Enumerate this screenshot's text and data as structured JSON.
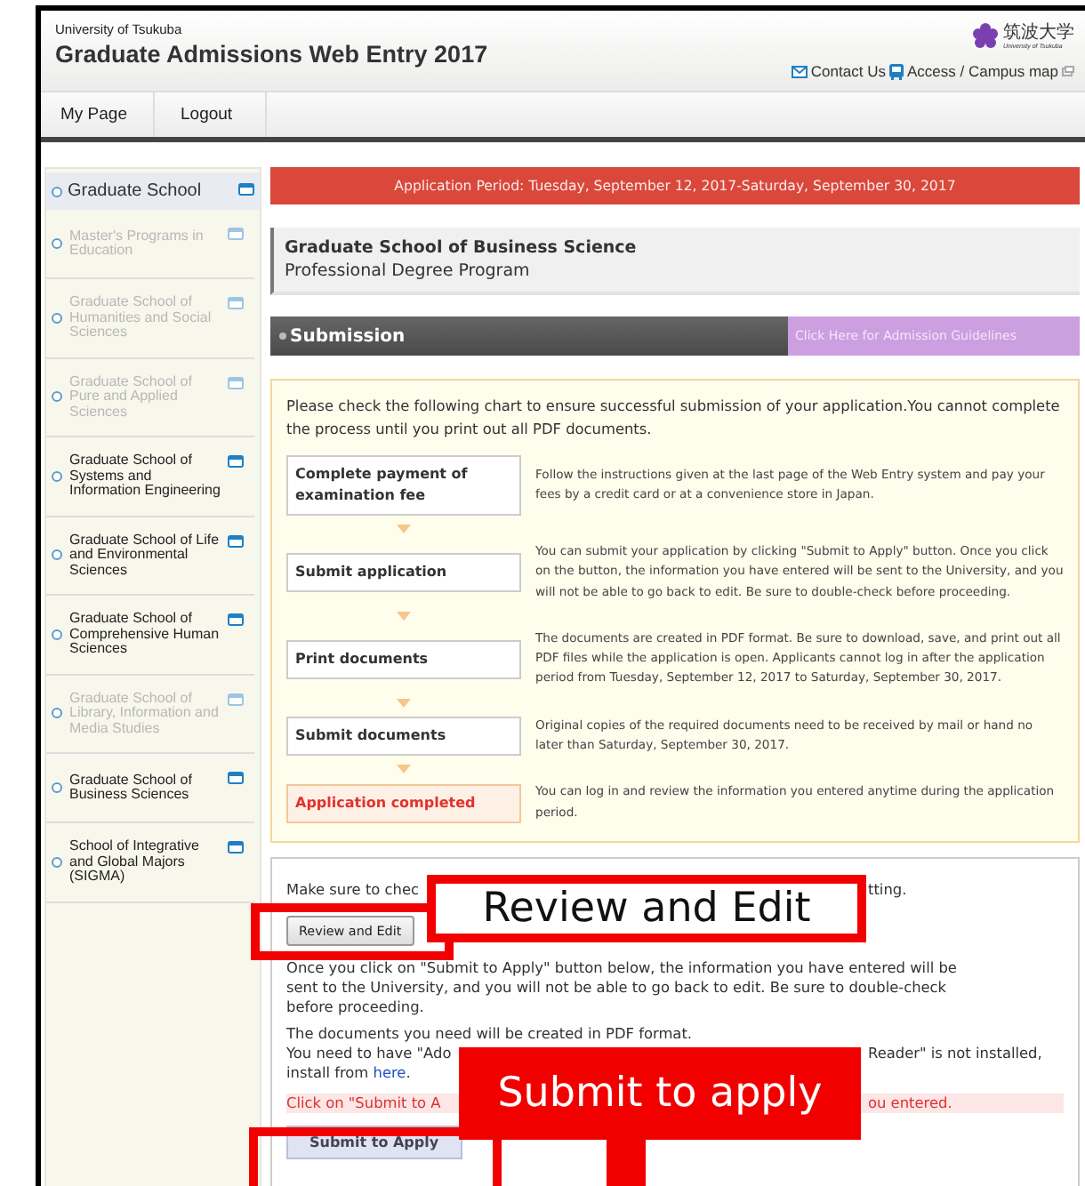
{
  "header": {
    "university": "University of Tsukuba",
    "title": "Graduate Admissions Web Entry 2017",
    "logo_text": "筑波大学",
    "logo_sub": "University of Tsukuba",
    "links": [
      {
        "label": "Contact Us",
        "kind": "mail"
      },
      {
        "label": "Access / Campus map",
        "kind": "bus"
      }
    ]
  },
  "nav": [
    {
      "label": "My Page"
    },
    {
      "label": "Logout"
    }
  ],
  "sidebar": {
    "heading": "Graduate School",
    "items": [
      {
        "label": "Master's Programs in Education",
        "disabled": true
      },
      {
        "label": "Graduate School of Humanities and Social Sciences",
        "disabled": true
      },
      {
        "label": "Graduate School of Pure and Applied Sciences",
        "disabled": true
      },
      {
        "label": "Graduate School of Systems and Information Engineering",
        "disabled": false
      },
      {
        "label": "Graduate School of Life and Environmental Sciences",
        "disabled": false
      },
      {
        "label": "Graduate School of Comprehensive Human Sciences",
        "disabled": false
      },
      {
        "label": "Graduate School of Library, Information and Media Studies",
        "disabled": true
      },
      {
        "label": "Graduate School of Business Sciences",
        "disabled": false
      },
      {
        "label": "School of Integrative and Global Majors (SIGMA)",
        "disabled": false
      }
    ]
  },
  "period": "Application Period: Tuesday, September 12, 2017-Saturday, September 30, 2017",
  "program": {
    "name": "Graduate School of Business Science",
    "type": "Professional Degree Program"
  },
  "section": {
    "title": "Submission",
    "guidelines_link": "Click Here for Admission Guidelines"
  },
  "chart": {
    "intro": "Please check the following chart to ensure successful submission of your application.You cannot complete the process until you print out all PDF documents.",
    "steps": [
      {
        "label": "Complete payment of examination fee",
        "description": "Follow the instructions given at the last page of the Web Entry system and pay your fees by a credit card or at a convenience store in Japan.",
        "kind": "normal"
      },
      {
        "label": "Submit application",
        "description": "You can submit your application by clicking \"Submit to Apply\" button. Once you click on the button, the information you have entered will be sent to the University, and you will not be able to go back to edit. Be sure to double-check before proceeding.",
        "kind": "normal"
      },
      {
        "label": "Print documents",
        "description": "The documents are created in PDF format. Be sure to download, save, and print out all PDF files while the application is open. Applicants cannot log in after the application period from Tuesday, September 12, 2017 to Saturday, September 30, 2017.",
        "kind": "normal"
      },
      {
        "label": "Submit documents",
        "description": "Original copies of the required documents need to be received by mail or hand no later than Saturday, September 30, 2017.",
        "kind": "normal"
      },
      {
        "label": "Application completed",
        "description": "You can log in and review the information you entered anytime during the application period.",
        "kind": "final"
      }
    ]
  },
  "confirm": {
    "check_start": "Make sure to chec",
    "check_end": "tting.",
    "review_button": "Review and Edit",
    "warning": "Once you click on \"Submit to Apply\" button below, the information you have entered will be sent to the University, and you will not be able to go back to edit. Be sure to double-check before proceeding.",
    "pdf_note": "The documents you need will be created in PDF format.",
    "adobe_start": "You need to have \"Ado",
    "adobe_end": "Reader\" is not installed,",
    "install_text": "install from ",
    "install_link": "here",
    "install_end": ".",
    "click_start": "Click on \"Submit to A",
    "click_end": "ou entered.",
    "submit_button": "Submit to Apply"
  },
  "callouts": [
    {
      "label": "Review and Edit",
      "kind": "outline"
    },
    {
      "label": "Submit to apply",
      "kind": "filled"
    }
  ]
}
